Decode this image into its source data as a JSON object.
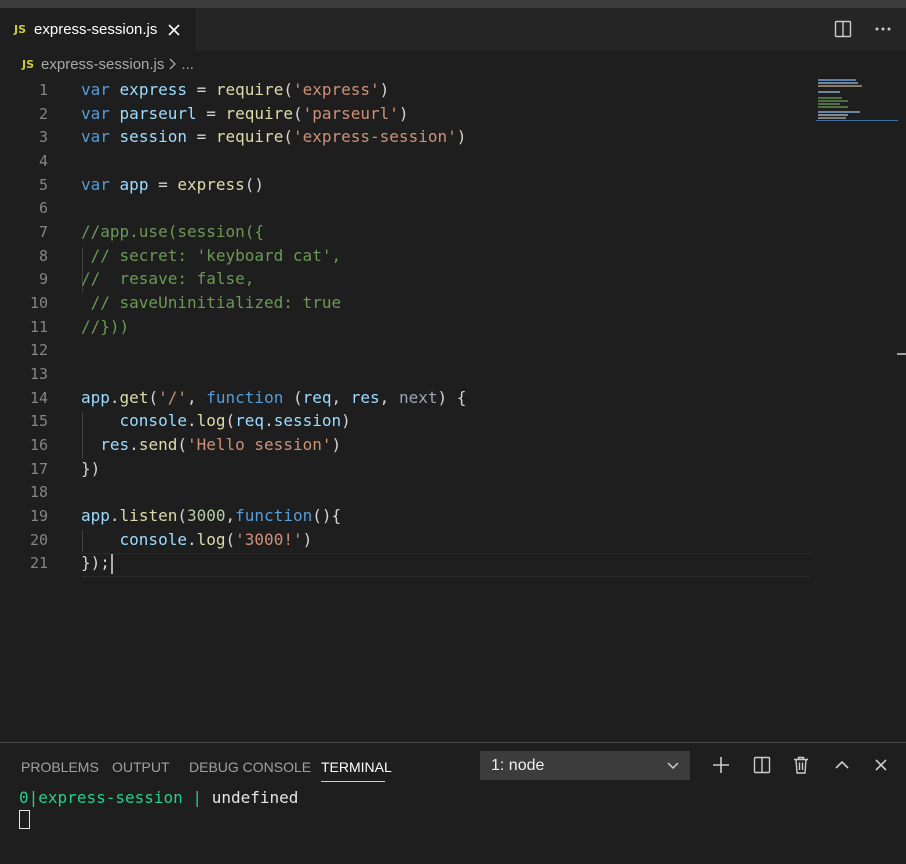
{
  "tab": {
    "badge": "JS",
    "filename": "express-session.js"
  },
  "breadcrumb": {
    "badge": "JS",
    "file": "express-session.js",
    "rest": "..."
  },
  "line_numbers": [
    "1",
    "2",
    "3",
    "4",
    "5",
    "6",
    "7",
    "8",
    "9",
    "10",
    "11",
    "12",
    "13",
    "14",
    "15",
    "16",
    "17",
    "18",
    "19",
    "20",
    "21"
  ],
  "code": [
    [
      [
        "kw",
        "var"
      ],
      [
        "p",
        " "
      ],
      [
        "var",
        "express"
      ],
      [
        "p",
        " = "
      ],
      [
        "fn",
        "require"
      ],
      [
        "p",
        "("
      ],
      [
        "str",
        "'express'"
      ],
      [
        "p",
        ")"
      ]
    ],
    [
      [
        "kw",
        "var"
      ],
      [
        "p",
        " "
      ],
      [
        "var",
        "parseurl"
      ],
      [
        "p",
        " = "
      ],
      [
        "fn",
        "require"
      ],
      [
        "p",
        "("
      ],
      [
        "str",
        "'parseurl'"
      ],
      [
        "p",
        ")"
      ]
    ],
    [
      [
        "kw",
        "var"
      ],
      [
        "p",
        " "
      ],
      [
        "var",
        "session"
      ],
      [
        "p",
        " = "
      ],
      [
        "fn",
        "require"
      ],
      [
        "p",
        "("
      ],
      [
        "str",
        "'express-session'"
      ],
      [
        "p",
        ")"
      ]
    ],
    [],
    [
      [
        "kw",
        "var"
      ],
      [
        "p",
        " "
      ],
      [
        "var",
        "app"
      ],
      [
        "p",
        " = "
      ],
      [
        "fn",
        "express"
      ],
      [
        "p",
        "()"
      ]
    ],
    [],
    [
      [
        "cmt",
        "//app.use(session({"
      ]
    ],
    [
      [
        "cmt",
        " // secret: 'keyboard cat',"
      ]
    ],
    [
      [
        "cmt",
        "//  resave: false,"
      ]
    ],
    [
      [
        "cmt",
        " // saveUninitialized: true"
      ]
    ],
    [
      [
        "cmt",
        "//}))"
      ]
    ],
    [],
    [],
    [
      [
        "var",
        "app"
      ],
      [
        "p",
        "."
      ],
      [
        "fn",
        "get"
      ],
      [
        "p",
        "("
      ],
      [
        "str",
        "'/'"
      ],
      [
        "p",
        ", "
      ],
      [
        "kw",
        "function"
      ],
      [
        "p",
        " ("
      ],
      [
        "var",
        "req"
      ],
      [
        "p",
        ", "
      ],
      [
        "var",
        "res"
      ],
      [
        "p",
        ", "
      ],
      [
        "next",
        "next"
      ],
      [
        "p",
        ") {"
      ]
    ],
    [
      [
        "p",
        "    "
      ],
      [
        "var",
        "console"
      ],
      [
        "p",
        "."
      ],
      [
        "fn",
        "log"
      ],
      [
        "p",
        "("
      ],
      [
        "var",
        "req"
      ],
      [
        "p",
        "."
      ],
      [
        "var",
        "session"
      ],
      [
        "p",
        ")"
      ]
    ],
    [
      [
        "p",
        "  "
      ],
      [
        "var",
        "res"
      ],
      [
        "p",
        "."
      ],
      [
        "fn",
        "send"
      ],
      [
        "p",
        "("
      ],
      [
        "str",
        "'Hello session'"
      ],
      [
        "p",
        ")"
      ]
    ],
    [
      [
        "p",
        "})"
      ]
    ],
    [],
    [
      [
        "var",
        "app"
      ],
      [
        "p",
        "."
      ],
      [
        "fn",
        "listen"
      ],
      [
        "p",
        "("
      ],
      [
        "num",
        "3000"
      ],
      [
        "p",
        ","
      ],
      [
        "kw",
        "function"
      ],
      [
        "p",
        "(){"
      ]
    ],
    [
      [
        "p",
        "    "
      ],
      [
        "var",
        "console"
      ],
      [
        "p",
        "."
      ],
      [
        "fn",
        "log"
      ],
      [
        "p",
        "("
      ],
      [
        "str",
        "'3000!'"
      ],
      [
        "p",
        ")"
      ]
    ],
    [
      [
        "p",
        "});"
      ]
    ]
  ],
  "panel": {
    "tabs": [
      "PROBLEMS",
      "OUTPUT",
      "DEBUG CONSOLE",
      "TERMINAL"
    ],
    "active_tab": "TERMINAL",
    "terminal_select": "1: node",
    "terminal": {
      "prefix": "0",
      "bar": "|",
      "name": "express-session",
      "bar2": " | ",
      "value": "undefined"
    }
  },
  "colors": {
    "keyword": "#569cd6",
    "variable": "#9cdcfe",
    "function": "#dcdcaa",
    "string": "#ce9178",
    "number": "#b5cea8",
    "comment": "#6a9955",
    "terminal_green": "#23d18b"
  },
  "icons": {
    "tab_close": "close-icon",
    "split": "split-editor-icon",
    "more": "more-actions-icon",
    "breadcrumb_sep": "chevron-right-icon",
    "dropdown": "chevron-down-icon",
    "new_terminal": "plus-icon",
    "split_terminal": "split-terminal-icon",
    "kill_terminal": "trash-icon",
    "maximize": "chevron-up-icon",
    "close_panel": "close-icon"
  }
}
